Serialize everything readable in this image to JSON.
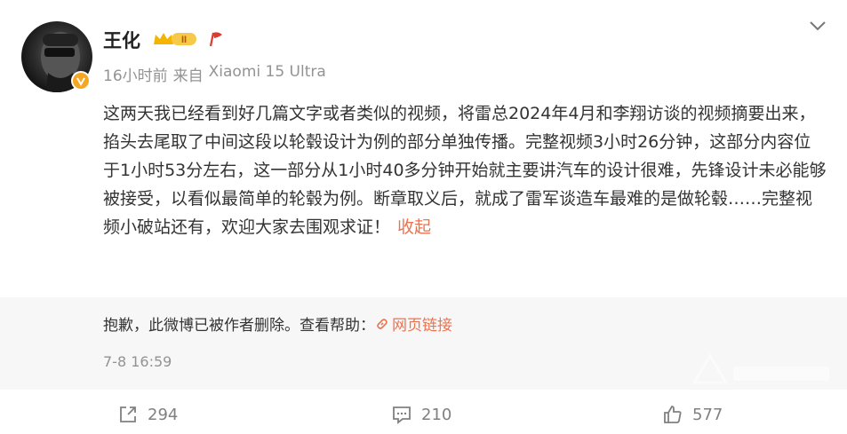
{
  "user": {
    "name": "王化",
    "level_badge_icon": "crown-level-badge-icon",
    "level_badge_text": "II",
    "extra_badge_icon": "red-flag-icon",
    "verified_icon": "orange-verified-icon"
  },
  "meta": {
    "time": "16小时前",
    "source_prefix": "来自",
    "source": "Xiaomi 15 Ultra"
  },
  "post": {
    "text": "这两天我已经看到好几篇文字或者类似的视频，将雷总2024年4月和李翔访谈的视频摘要出来，掐头去尾取了中间这段以轮毂设计为例的部分单独传播。完整视频3小时26分钟，这部分内容位于1小时53分左右，这一部分从1小时40多分钟开始就主要讲汽车的设计很难，先锋设计未必能够被接受，以看似最简单的轮毂为例。断章取义后，就成了雷军谈造车最难的是做轮毂……完整视频小破站还有，欢迎大家去围观求证！",
    "collapse_label": "收起"
  },
  "deleted_repost": {
    "message": "抱歉，此微博已被作者删除。查看帮助：",
    "link_label": "网页链接",
    "time": "7-8 16:59"
  },
  "actions": {
    "repost_count": "294",
    "comment_count": "210",
    "like_count": "577"
  },
  "colors": {
    "accent": "#eb7350",
    "muted": "#939393",
    "deleted_bg": "#f7f7f7",
    "badge_gold": "#f5a623"
  }
}
